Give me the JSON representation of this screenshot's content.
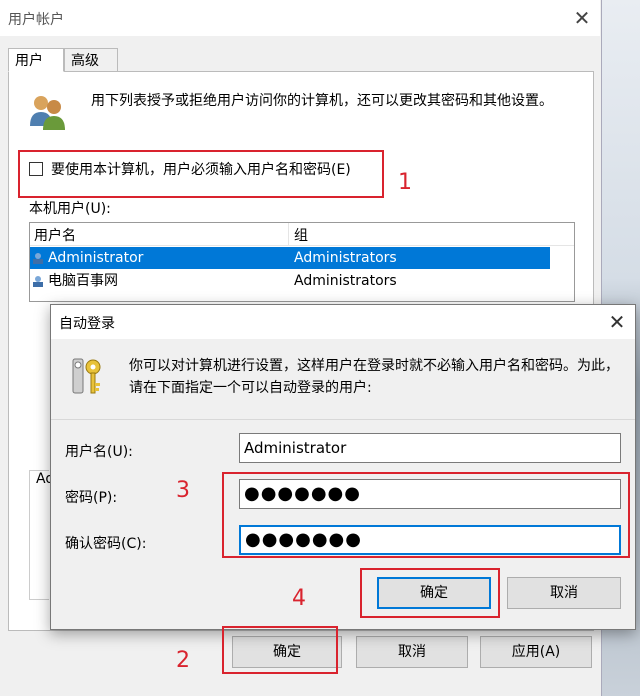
{
  "main_window": {
    "title": "用户帐户",
    "tabs": [
      {
        "label": "用户"
      },
      {
        "label": "高级"
      }
    ],
    "description": "用下列表授予或拒绝用户访问你的计算机，还可以更改其密码和其他设置。",
    "checkbox_label": "要使用本计算机，用户必须输入用户名和密码(E)",
    "checkbox_checked": false,
    "local_users_label": "本机用户(U):",
    "columns": [
      "用户名",
      "组"
    ],
    "rows": [
      {
        "username": "Administrator",
        "group": "Administrators",
        "selected": true
      },
      {
        "username": "电脑百事网",
        "group": "Administrators",
        "selected": false
      }
    ],
    "partial_group_label": "Ad",
    "buttons": {
      "ok": "确定",
      "cancel": "取消",
      "apply": "应用(A)"
    }
  },
  "auto_login_dialog": {
    "title": "自动登录",
    "description": "你可以对计算机进行设置，这样用户在登录时就不必输入用户名和密码。为此，请在下面指定一个可以自动登录的用户:",
    "username_label": "用户名(U):",
    "username_value": "Administrator",
    "password_label": "密码(P):",
    "password_value": "●●●●●●●",
    "confirm_label": "确认密码(C):",
    "confirm_value": "●●●●●●●",
    "buttons": {
      "ok": "确定",
      "cancel": "取消"
    }
  },
  "annotations": [
    "1",
    "2",
    "3",
    "4"
  ],
  "colors": {
    "accent": "#0078d7",
    "annotation_red": "#d9232e"
  }
}
